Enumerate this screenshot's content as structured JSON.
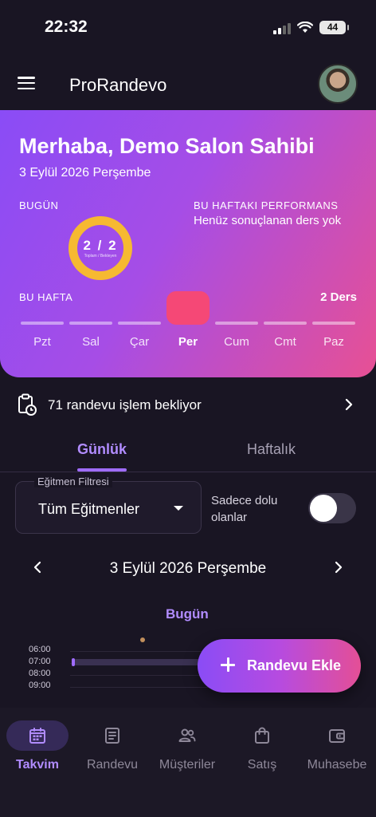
{
  "status_bar": {
    "time": "22:32",
    "battery": "44"
  },
  "header": {
    "title": "ProRandevo"
  },
  "hero": {
    "greeting": "Merhaba, Demo Salon Sahibi",
    "date": "3 Eylül 2026 Perşembe",
    "today_label": "BUGÜN",
    "today_ring": {
      "value": "2 / 2",
      "sub": "Toplam / Bekleyen",
      "progress": 1.0
    },
    "performance_label": "BU HAFTAKI PERFORMANS",
    "performance_text": "Henüz sonuçlanan ders yok",
    "week_label": "BU HAFTA",
    "week_count": "2 Ders",
    "days": [
      {
        "label": "Pzt",
        "active": false
      },
      {
        "label": "Sal",
        "active": false
      },
      {
        "label": "Çar",
        "active": false
      },
      {
        "label": "Per",
        "active": true
      },
      {
        "label": "Cum",
        "active": false
      },
      {
        "label": "Cmt",
        "active": false
      },
      {
        "label": "Paz",
        "active": false
      }
    ]
  },
  "pending": {
    "text": "71 randevu işlem bekliyor"
  },
  "tabs": [
    {
      "label": "Günlük",
      "active": true
    },
    {
      "label": "Haftalık",
      "active": false
    }
  ],
  "filter": {
    "legend": "Eğitmen Filtresi",
    "value": "Tüm Eğitmenler",
    "toggle_label": "Sadece dolu olanlar",
    "toggle_on": false
  },
  "date_nav": {
    "title": "3 Eylül 2026 Perşembe"
  },
  "schedule": {
    "today_tag": "Bugün",
    "times": [
      "06:00",
      "07:00",
      "08:00",
      "09:00"
    ]
  },
  "fab": {
    "label": "Randevu Ekle"
  },
  "bottom_nav": [
    {
      "label": "Takvim",
      "icon": "calendar-icon",
      "active": true
    },
    {
      "label": "Randevu",
      "icon": "list-icon",
      "active": false
    },
    {
      "label": "Müşteriler",
      "icon": "people-icon",
      "active": false
    },
    {
      "label": "Satış",
      "icon": "shopping-bag-icon",
      "active": false
    },
    {
      "label": "Muhasebe",
      "icon": "wallet-icon",
      "active": false
    }
  ],
  "colors": {
    "accent": "#b18cff",
    "ring": "#f6b931",
    "active_day": "#f54876"
  }
}
